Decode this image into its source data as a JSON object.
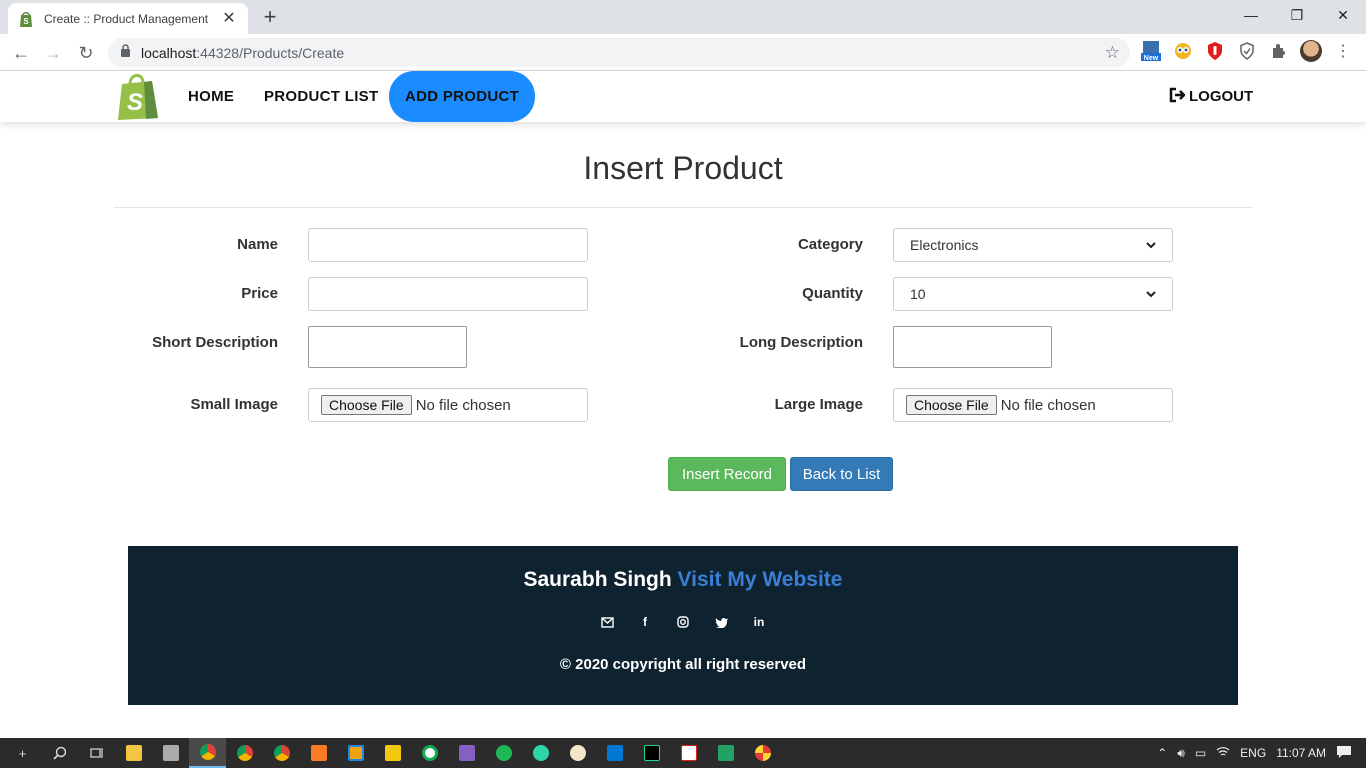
{
  "browser": {
    "tab_title": "Create :: Product Management",
    "url_host": "localhost",
    "url_rest": ":44328/Products/Create",
    "ext_new_badge": "New"
  },
  "nav": {
    "home": "HOME",
    "product_list": "PRODUCT LIST",
    "add_product": "ADD PRODUCT",
    "logout": "LOGOUT"
  },
  "form": {
    "title": "Insert Product",
    "name_label": "Name",
    "price_label": "Price",
    "short_desc_label": "Short Description",
    "small_image_label": "Small Image",
    "category_label": "Category",
    "category_value": "Electronics",
    "quantity_label": "Quantity",
    "quantity_value": "10",
    "long_desc_label": "Long Description",
    "large_image_label": "Large Image",
    "file_button": "Choose File",
    "file_status": "No file chosen",
    "insert_button": "Insert Record",
    "back_button": "Back to List"
  },
  "footer": {
    "name": "Saurabh Singh",
    "link": "Visit My Website",
    "copyright": "© 2020 copyright all right reserved",
    "social_icons": [
      "mail-icon",
      "facebook-icon",
      "instagram-icon",
      "twitter-icon",
      "linkedin-icon"
    ]
  },
  "taskbar": {
    "language": "ENG",
    "time": "11:07 AM"
  },
  "colors": {
    "active_nav": "#1a8cff",
    "insert_button": "#5cb85c",
    "back_button": "#337ab7",
    "footer_bg": "#0f2230",
    "footer_link": "#3a7fd5"
  }
}
